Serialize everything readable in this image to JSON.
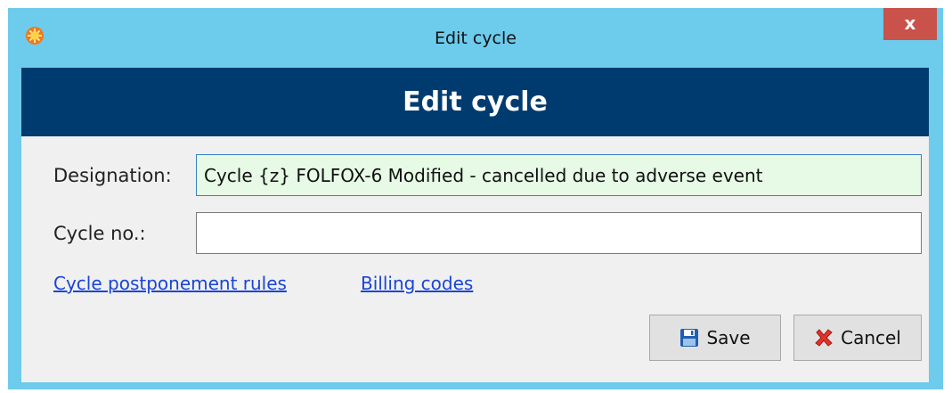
{
  "window": {
    "title": "Edit cycle",
    "close_label": "x"
  },
  "header": {
    "title": "Edit cycle"
  },
  "form": {
    "designation_label": "Designation:",
    "designation_value": "Cycle {z} FOLFOX-6 Modified - cancelled due to adverse event",
    "cycle_no_label": "Cycle no.:",
    "cycle_no_value": ""
  },
  "links": {
    "postponement": "Cycle postponement rules",
    "billing": "Billing codes"
  },
  "buttons": {
    "save": "Save",
    "cancel": "Cancel"
  },
  "icons": {
    "app": "sun-icon",
    "save": "floppy-disk-icon",
    "cancel": "red-x-icon"
  },
  "colors": {
    "titlebar": "#6dcbec",
    "header_band": "#003b6f",
    "close_button": "#c9524a",
    "focused_field": "#e6fae6",
    "link": "#1a45d6"
  }
}
